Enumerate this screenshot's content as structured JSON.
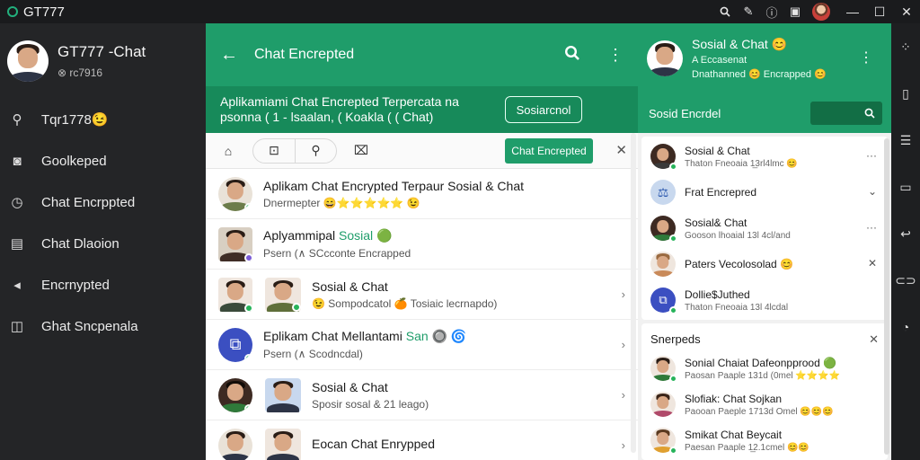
{
  "titlebar": {
    "app_name": "GT777",
    "icons": [
      "search-icon",
      "pen-icon",
      "info-icon",
      "book-icon",
      "user-avatar"
    ],
    "window": {
      "minimize": "—",
      "maximize": "☐",
      "close": "✕"
    }
  },
  "sidebar": {
    "profile": {
      "title": "GT777 -Chat",
      "subtitle": "⊗ rc7916"
    },
    "items": [
      {
        "label": "Tqr1778😉",
        "icon": "pin-icon"
      },
      {
        "label": "Goolkeped",
        "icon": "shield-icon"
      },
      {
        "label": "Chat Encrppted",
        "icon": "clock-icon"
      },
      {
        "label": "Chat Dlaoion",
        "icon": "panel-icon"
      },
      {
        "label": "Encrnypted",
        "icon": "send-icon"
      },
      {
        "label": "Ghat Sncpenala",
        "icon": "book-icon"
      }
    ]
  },
  "center": {
    "header": {
      "title": "Chat Encrepted"
    },
    "banner": {
      "line1": "Aplikamiami Chat Encrepted Terpercata na",
      "line2": "psonna ( 1 - lsaalan, ( Koakla ( ( Chat)",
      "button": "Sosiarcnol"
    },
    "toolbar": {
      "button": "Chat Encrepted"
    },
    "rows": [
      {
        "title": "Aplikam Chat Encrypted Terpaur Sosial & Chat",
        "sub": "Dnermepter 😄⭐⭐⭐⭐⭐ 😉",
        "chev": ""
      },
      {
        "title": "Aplyammipal ",
        "title_accent": "Sosial",
        "title_tail": " 🟢",
        "sub": "Psern (∧ SCcconte Encrapped",
        "chev": ""
      },
      {
        "title": "Sosial & Chat",
        "sub": "😉 Sompodcatol 🍊 Tosiaic lecrnapdo)",
        "chev": "›"
      },
      {
        "title": "Eplikam Chat Mellantami ",
        "title_accent": "San",
        "title_tail": " 🔘 🌀",
        "sub": "Psern (∧ Scodncdal)",
        "chev": "›"
      },
      {
        "title": "Sosial & Chat",
        "sub": "Sposir sosal & 21 leago)",
        "chev": "›"
      },
      {
        "title": "Eocan Chat Enrypped",
        "sub": "",
        "chev": "›"
      }
    ]
  },
  "right": {
    "header": {
      "title": "Sosial & Chat 😊",
      "line1": "A Eccasenat",
      "line2": "Dnathanned 😊 Encrapped 😊"
    },
    "search": {
      "label": "Sosid Encrdel"
    },
    "card1": [
      {
        "name": "Sosial & Chat",
        "line": "Thaton Fneoaia 1̲3rl4lmc 😊"
      },
      {
        "name": "Frat Encrepred",
        "line": ""
      },
      {
        "name": "Sosial& Chat",
        "line": "Gooson lhoaial 13l 4cl/and"
      },
      {
        "name": "Paters Vecolosolad 😊",
        "line": ""
      },
      {
        "name": "Dollie$Juthed",
        "line": "Thaton Fneoaia 13l 4lcdal"
      }
    ],
    "section_title": "Snerpeds",
    "card2": [
      {
        "name": "Sonial Chaiat Dafeonpprood 🟢",
        "line": "Paosan Paaple 131d (0mel ⭐⭐⭐⭐"
      },
      {
        "name": "Slofiak: Chat Sojkan",
        "line": "Paooan Paeple 1713d Omel 😊😊😊"
      },
      {
        "name": "Smikat Chat Beycait",
        "line": "Paesan Paaple 1̲2.1cmel 😊😊"
      }
    ]
  }
}
